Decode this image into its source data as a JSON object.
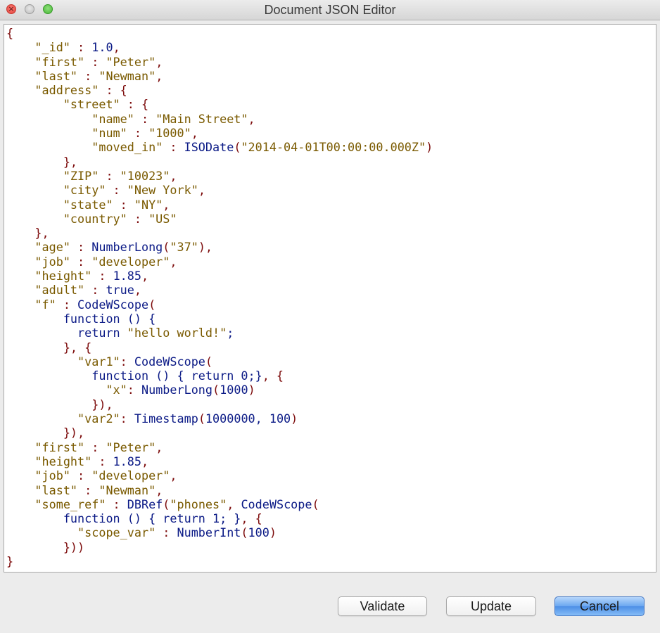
{
  "window": {
    "title": "Document JSON Editor",
    "controls": {
      "close_glyph": "×",
      "minimize_glyph": "",
      "zoom_glyph": ""
    }
  },
  "editor": {
    "lines": [
      [
        {
          "t": "k",
          "v": "{"
        }
      ],
      [
        {
          "t": "s",
          "v": "    \"_id\""
        },
        {
          "t": "k",
          "v": " : "
        },
        {
          "t": "v",
          "v": "1.0"
        },
        {
          "t": "k",
          "v": ","
        }
      ],
      [
        {
          "t": "s",
          "v": "    \"first\""
        },
        {
          "t": "k",
          "v": " : "
        },
        {
          "t": "s",
          "v": "\"Peter\""
        },
        {
          "t": "k",
          "v": ","
        }
      ],
      [
        {
          "t": "s",
          "v": "    \"last\""
        },
        {
          "t": "k",
          "v": " : "
        },
        {
          "t": "s",
          "v": "\"Newman\""
        },
        {
          "t": "k",
          "v": ","
        }
      ],
      [
        {
          "t": "s",
          "v": "    \"address\""
        },
        {
          "t": "k",
          "v": " : {"
        }
      ],
      [
        {
          "t": "s",
          "v": "        \"street\""
        },
        {
          "t": "k",
          "v": " : {"
        }
      ],
      [
        {
          "t": "s",
          "v": "            \"name\""
        },
        {
          "t": "k",
          "v": " : "
        },
        {
          "t": "s",
          "v": "\"Main Street\""
        },
        {
          "t": "k",
          "v": ","
        }
      ],
      [
        {
          "t": "s",
          "v": "            \"num\""
        },
        {
          "t": "k",
          "v": " : "
        },
        {
          "t": "s",
          "v": "\"1000\""
        },
        {
          "t": "k",
          "v": ","
        }
      ],
      [
        {
          "t": "s",
          "v": "            \"moved_in\""
        },
        {
          "t": "k",
          "v": " : "
        },
        {
          "t": "v",
          "v": "ISODate"
        },
        {
          "t": "k",
          "v": "("
        },
        {
          "t": "s",
          "v": "\"2014-04-01T00:00:00.000Z\""
        },
        {
          "t": "k",
          "v": ")"
        }
      ],
      [
        {
          "t": "k",
          "v": "        },"
        }
      ],
      [
        {
          "t": "s",
          "v": "        \"ZIP\""
        },
        {
          "t": "k",
          "v": " : "
        },
        {
          "t": "s",
          "v": "\"10023\""
        },
        {
          "t": "k",
          "v": ","
        }
      ],
      [
        {
          "t": "s",
          "v": "        \"city\""
        },
        {
          "t": "k",
          "v": " : "
        },
        {
          "t": "s",
          "v": "\"New York\""
        },
        {
          "t": "k",
          "v": ","
        }
      ],
      [
        {
          "t": "s",
          "v": "        \"state\""
        },
        {
          "t": "k",
          "v": " : "
        },
        {
          "t": "s",
          "v": "\"NY\""
        },
        {
          "t": "k",
          "v": ","
        }
      ],
      [
        {
          "t": "s",
          "v": "        \"country\""
        },
        {
          "t": "k",
          "v": " : "
        },
        {
          "t": "s",
          "v": "\"US\""
        }
      ],
      [
        {
          "t": "k",
          "v": "    },"
        }
      ],
      [
        {
          "t": "s",
          "v": "    \"age\""
        },
        {
          "t": "k",
          "v": " : "
        },
        {
          "t": "v",
          "v": "NumberLong"
        },
        {
          "t": "k",
          "v": "("
        },
        {
          "t": "s",
          "v": "\"37\""
        },
        {
          "t": "k",
          "v": "),"
        }
      ],
      [
        {
          "t": "s",
          "v": "    \"job\""
        },
        {
          "t": "k",
          "v": " : "
        },
        {
          "t": "s",
          "v": "\"developer\""
        },
        {
          "t": "k",
          "v": ","
        }
      ],
      [
        {
          "t": "s",
          "v": "    \"height\""
        },
        {
          "t": "k",
          "v": " : "
        },
        {
          "t": "v",
          "v": "1.85"
        },
        {
          "t": "k",
          "v": ","
        }
      ],
      [
        {
          "t": "s",
          "v": "    \"adult\""
        },
        {
          "t": "k",
          "v": " : "
        },
        {
          "t": "v",
          "v": "true"
        },
        {
          "t": "k",
          "v": ","
        }
      ],
      [
        {
          "t": "s",
          "v": "    \"f\""
        },
        {
          "t": "k",
          "v": " : "
        },
        {
          "t": "v",
          "v": "CodeWScope"
        },
        {
          "t": "k",
          "v": "("
        }
      ],
      [
        {
          "t": "v",
          "v": "        function () {"
        }
      ],
      [
        {
          "t": "v",
          "v": "          return "
        },
        {
          "t": "s",
          "v": "\"hello world!\""
        },
        {
          "t": "v",
          "v": ";"
        }
      ],
      [
        {
          "t": "k",
          "v": "        }, {"
        }
      ],
      [
        {
          "t": "s",
          "v": "          \"var1\""
        },
        {
          "t": "k",
          "v": ": "
        },
        {
          "t": "v",
          "v": "CodeWScope"
        },
        {
          "t": "k",
          "v": "("
        }
      ],
      [
        {
          "t": "v",
          "v": "            function () { return 0;}"
        },
        {
          "t": "k",
          "v": ", {"
        }
      ],
      [
        {
          "t": "s",
          "v": "              \"x\""
        },
        {
          "t": "k",
          "v": ": "
        },
        {
          "t": "v",
          "v": "NumberLong"
        },
        {
          "t": "k",
          "v": "("
        },
        {
          "t": "v",
          "v": "1000"
        },
        {
          "t": "k",
          "v": ")"
        }
      ],
      [
        {
          "t": "k",
          "v": "            }),"
        }
      ],
      [
        {
          "t": "s",
          "v": "          \"var2\""
        },
        {
          "t": "k",
          "v": ": "
        },
        {
          "t": "v",
          "v": "Timestamp"
        },
        {
          "t": "k",
          "v": "("
        },
        {
          "t": "v",
          "v": "1000000, 100"
        },
        {
          "t": "k",
          "v": ")"
        }
      ],
      [
        {
          "t": "k",
          "v": "        }),"
        }
      ],
      [
        {
          "t": "s",
          "v": "    \"first\""
        },
        {
          "t": "k",
          "v": " : "
        },
        {
          "t": "s",
          "v": "\"Peter\""
        },
        {
          "t": "k",
          "v": ","
        }
      ],
      [
        {
          "t": "s",
          "v": "    \"height\""
        },
        {
          "t": "k",
          "v": " : "
        },
        {
          "t": "v",
          "v": "1.85"
        },
        {
          "t": "k",
          "v": ","
        }
      ],
      [
        {
          "t": "s",
          "v": "    \"job\""
        },
        {
          "t": "k",
          "v": " : "
        },
        {
          "t": "s",
          "v": "\"developer\""
        },
        {
          "t": "k",
          "v": ","
        }
      ],
      [
        {
          "t": "s",
          "v": "    \"last\""
        },
        {
          "t": "k",
          "v": " : "
        },
        {
          "t": "s",
          "v": "\"Newman\""
        },
        {
          "t": "k",
          "v": ","
        }
      ],
      [
        {
          "t": "s",
          "v": "    \"some_ref\""
        },
        {
          "t": "k",
          "v": " : "
        },
        {
          "t": "v",
          "v": "DBRef"
        },
        {
          "t": "k",
          "v": "("
        },
        {
          "t": "s",
          "v": "\"phones\""
        },
        {
          "t": "k",
          "v": ", "
        },
        {
          "t": "v",
          "v": "CodeWScope"
        },
        {
          "t": "k",
          "v": "("
        }
      ],
      [
        {
          "t": "v",
          "v": "        function () { return 1; }"
        },
        {
          "t": "k",
          "v": ", {"
        }
      ],
      [
        {
          "t": "s",
          "v": "          \"scope_var\""
        },
        {
          "t": "k",
          "v": " : "
        },
        {
          "t": "v",
          "v": "NumberInt"
        },
        {
          "t": "k",
          "v": "("
        },
        {
          "t": "v",
          "v": "100"
        },
        {
          "t": "k",
          "v": ")"
        }
      ],
      [
        {
          "t": "k",
          "v": "        }))"
        }
      ],
      [
        {
          "t": "k",
          "v": "}"
        }
      ]
    ]
  },
  "buttons": {
    "validate_label": "Validate",
    "update_label": "Update",
    "cancel_label": "Cancel"
  },
  "colors": {
    "key": "#7a5a00",
    "punctuation": "#7d0c0c",
    "value": "#0b1a86",
    "default_button": "#4c8fe6"
  }
}
